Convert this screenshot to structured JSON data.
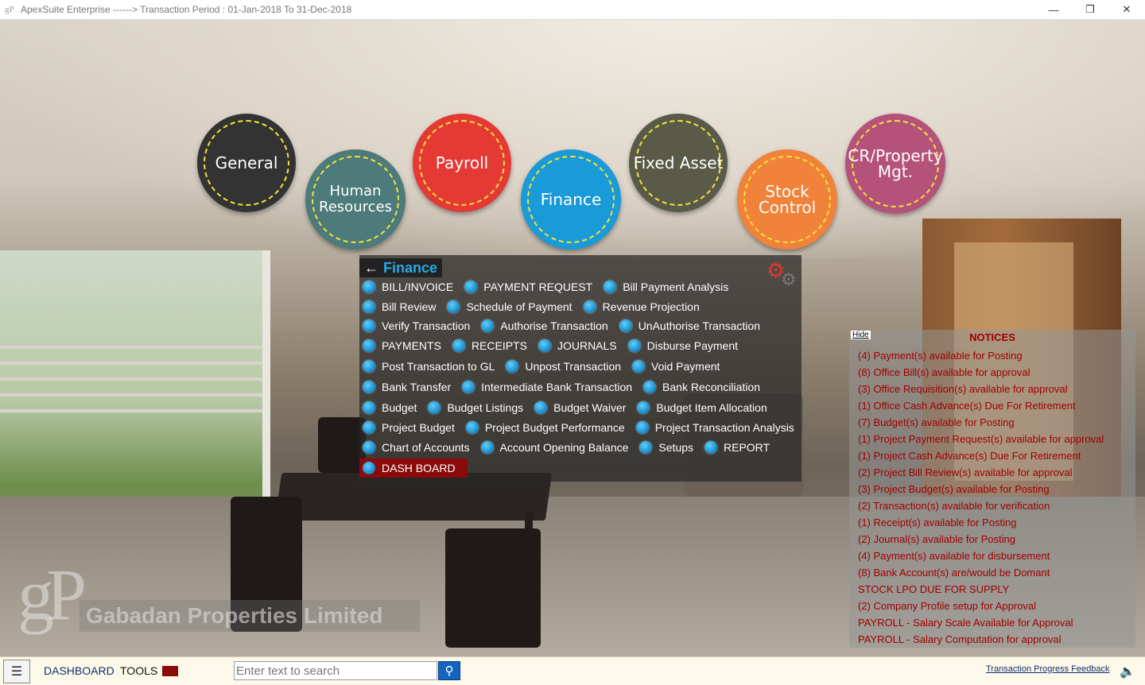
{
  "window": {
    "icon": "gP",
    "title": "ApexSuite Enterprise ------> Transaction Period : 01-Jan-2018 To 31-Dec-2018",
    "minimize": "—",
    "maximize": "❐",
    "close": "✕"
  },
  "modules": [
    {
      "label": "General",
      "color": "#333333"
    },
    {
      "label": "Human Resources",
      "color": "#4d7a7a"
    },
    {
      "label": "Payroll",
      "color": "#e53935"
    },
    {
      "label": "Finance",
      "color": "#1a9ad6"
    },
    {
      "label": "Fixed Asset",
      "color": "#5a5a48"
    },
    {
      "label": "Stock Control",
      "color": "#f0823a"
    },
    {
      "label": "CR/Property Mgt.",
      "color": "#b5527a"
    }
  ],
  "finance_panel": {
    "back": "←",
    "title": "Finance",
    "rows": [
      [
        "BILL/INVOICE",
        "PAYMENT REQUEST",
        "Bill Payment Analysis"
      ],
      [
        "Bill Review",
        "Schedule of Payment",
        "Revenue Projection"
      ],
      [
        "Verify Transaction",
        "Authorise Transaction",
        "UnAuthorise Transaction"
      ],
      [
        "PAYMENTS",
        "RECEIPTS",
        "JOURNALS",
        "Disburse Payment"
      ],
      [
        "Post Transaction to GL",
        "Unpost Transaction",
        "Void Payment"
      ],
      [
        "Bank Transfer",
        "Intermediate Bank Transaction",
        "Bank Reconciliation"
      ],
      [
        "Budget",
        "Budget Listings",
        "Budget Waiver",
        "Budget Item Allocation"
      ],
      [
        "Project Budget",
        "Project Budget Performance",
        "Project Transaction Analysis"
      ],
      [
        "Chart of Accounts",
        "Account Opening Balance",
        "Setups",
        "REPORT"
      ]
    ],
    "dashboard": "DASH BOARD"
  },
  "notices": {
    "hide": "Hide",
    "title": "NOTICES",
    "items": [
      "(4) Payment(s) available for Posting",
      "(8) Office Bill(s) available for approval",
      "(3) Office Requisition(s) available for approval",
      "(1) Office Cash Advance(s) Due For Retirement",
      "(7) Budget(s) available for Posting",
      "(1) Project Payment Request(s) available for approval",
      "(1) Project Cash Advance(s) Due For Retirement",
      "(2) Project Bill Review(s) available for approval",
      "(3) Project Budget(s) available for Posting",
      "(2) Transaction(s) available for verification",
      "(1) Receipt(s) available for Posting",
      "(2) Journal(s) available for Posting",
      "(4) Payment(s) available for disbursement",
      "(8) Bank Account(s) are/would be Domant",
      "STOCK LPO DUE FOR SUPPLY",
      "(2) Company Profile setup for Approval",
      "PAYROLL - Salary Scale Available for Approval",
      "PAYROLL - Salary Computation for approval"
    ]
  },
  "branding": {
    "logo": "gP",
    "company": "Gabadan Properties Limited"
  },
  "bottom": {
    "menu": "☰",
    "dashboard": "DASHBOARD",
    "tools": "TOOLS",
    "search_placeholder": "Enter text to search",
    "search_icon": "⚲",
    "feedback": "Transaction Progress Feedback",
    "speaker": "🔈"
  }
}
